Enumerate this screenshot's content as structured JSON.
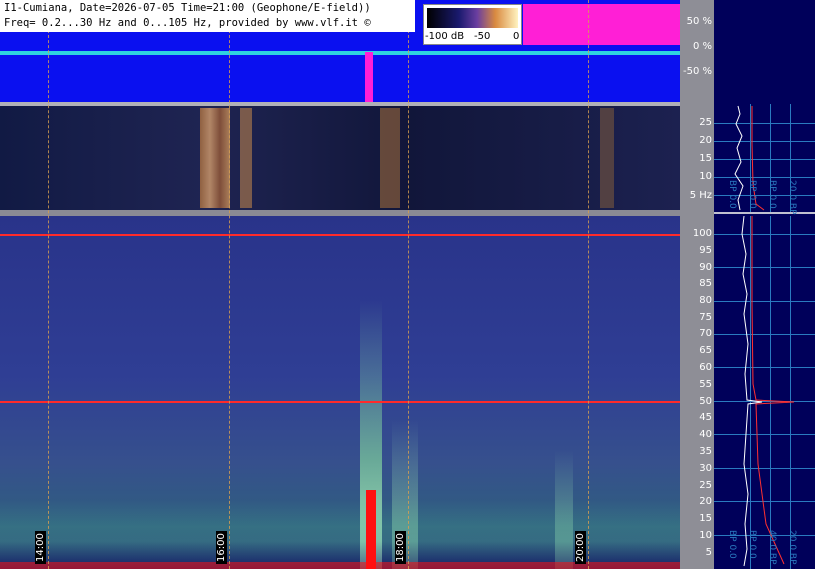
{
  "header": {
    "line1": "I1-Cumiana, Date=2026-07-05 Time=21:00 (Geophone/E-field))",
    "line2": "Freq= 0.2...30 Hz and 0...105 Hz, provided by www.vlf.it ©"
  },
  "colorbar": {
    "labels": [
      "-100 dB",
      "-50",
      "0"
    ]
  },
  "amplitude_axis": {
    "labels": [
      "50 %",
      "0 %",
      "-50 %"
    ]
  },
  "low_freq_axis": {
    "labels": [
      "25",
      "20",
      "15",
      "10",
      "5 Hz"
    ]
  },
  "high_freq_axis": {
    "labels": [
      "100",
      "95",
      "90",
      "85",
      "80",
      "75",
      "70",
      "65",
      "60",
      "55",
      "50",
      "45",
      "40",
      "35",
      "30",
      "25",
      "20",
      "15",
      "10",
      "5"
    ]
  },
  "time_axis": {
    "labels": [
      "14:00",
      "16:00",
      "18:00",
      "20:00"
    ]
  },
  "profile_labels": {
    "top": [
      "BP 0.0",
      "BP 0.0",
      "BP 0.0",
      "20.0 BP"
    ],
    "bottom": [
      "BP 0.0",
      "BP 0.0",
      "40.0 BP",
      "20.0 BP"
    ]
  },
  "colors": {
    "waveform_bg": "#0a10f0",
    "waveform_line": "#2fd3e0",
    "clip_magenta": "#ff1fd6",
    "grid_orange": "#d8a050",
    "line_red": "#ff2a2a",
    "profile_bg": "#00005a",
    "profile_grid": "#2a7ac0"
  }
}
